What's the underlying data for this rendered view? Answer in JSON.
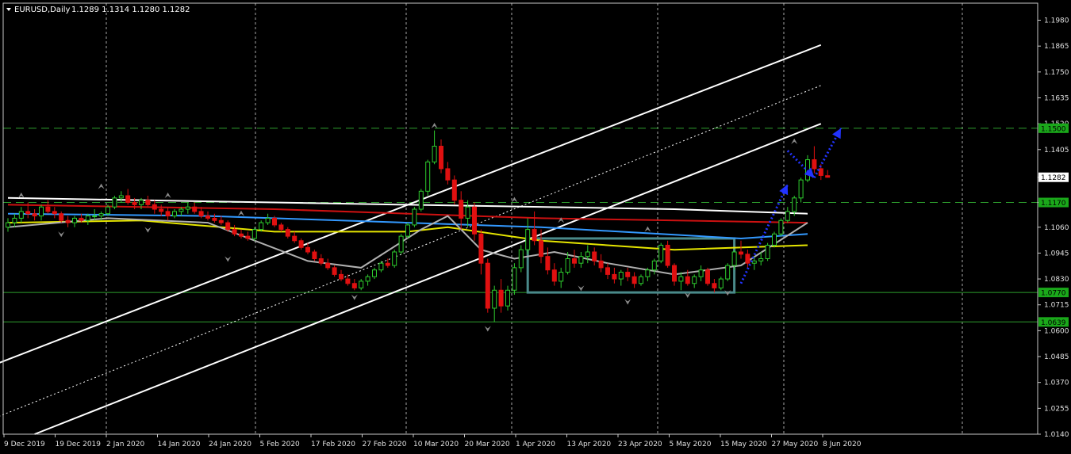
{
  "header": {
    "symbol": "EURUSD,Daily",
    "ohlc": "1.1289 1.1314 1.1280 1.1282"
  },
  "colors": {
    "background": "#000000",
    "bull_candle": "#2ecc2e",
    "bear_candle": "#e01010",
    "ma_white": "#ffffff",
    "ma_red": "#cc1111",
    "ma_blue": "#3399ff",
    "ma_yellow": "#e6e600",
    "ma_gray": "#b0b0b0",
    "channel": "#ffffff",
    "level_line": "#2e9e2e",
    "level_label_bg": "#1aa81a",
    "range_box": "#4a8a8a",
    "forecast_arrow": "#2233ff",
    "fractal": "#8a8a8a"
  },
  "chart_data": {
    "type": "candlestick",
    "symbol": "EURUSD",
    "timeframe": "Daily",
    "ylim": [
      1.014,
      1.201
    ],
    "y_ticks": [
      "1.1980",
      "1.1865",
      "1.1750",
      "1.1635",
      "1.1520",
      "1.1405",
      "1.1282",
      "1.1170",
      "1.1060",
      "1.0945",
      "1.0830",
      "1.0715",
      "1.0600",
      "1.0485",
      "1.0370",
      "1.0255",
      "1.0140"
    ],
    "price_labels": [
      {
        "text": "1.1500",
        "value": 1.15,
        "style": "level"
      },
      {
        "text": "1.1282",
        "value": 1.1282,
        "style": "current"
      },
      {
        "text": "1.1170",
        "value": 1.117,
        "style": "level"
      },
      {
        "text": "1.0770",
        "value": 1.077,
        "style": "level"
      },
      {
        "text": "1.0639",
        "value": 1.0639,
        "style": "level"
      }
    ],
    "x_labels": [
      "9 Dec 2019",
      "19 Dec 2019",
      "2 Jan 2020",
      "14 Jan 2020",
      "24 Jan 2020",
      "5 Feb 2020",
      "17 Feb 2020",
      "27 Feb 2020",
      "10 Mar 2020",
      "20 Mar 2020",
      "1 Apr 2020",
      "13 Apr 2020",
      "23 Apr 2020",
      "5 May 2020",
      "15 May 2020",
      "27 May 2020",
      "8 Jun 2020"
    ],
    "candles": [
      [
        1.106,
        1.11,
        1.104,
        1.108
      ],
      [
        1.108,
        1.112,
        1.106,
        1.11
      ],
      [
        1.11,
        1.115,
        1.108,
        1.113
      ],
      [
        1.113,
        1.117,
        1.11,
        1.112
      ],
      [
        1.112,
        1.114,
        1.109,
        1.111
      ],
      [
        1.111,
        1.116,
        1.109,
        1.115
      ],
      [
        1.115,
        1.118,
        1.112,
        1.113
      ],
      [
        1.113,
        1.115,
        1.11,
        1.112
      ],
      [
        1.112,
        1.113,
        1.108,
        1.109
      ],
      [
        1.109,
        1.111,
        1.106,
        1.108
      ],
      [
        1.108,
        1.111,
        1.106,
        1.11
      ],
      [
        1.11,
        1.112,
        1.108,
        1.109
      ],
      [
        1.109,
        1.112,
        1.107,
        1.111
      ],
      [
        1.111,
        1.114,
        1.109,
        1.111
      ],
      [
        1.111,
        1.113,
        1.109,
        1.112
      ],
      [
        1.112,
        1.116,
        1.111,
        1.115
      ],
      [
        1.115,
        1.12,
        1.114,
        1.119
      ],
      [
        1.119,
        1.122,
        1.117,
        1.12
      ],
      [
        1.12,
        1.123,
        1.116,
        1.117
      ],
      [
        1.117,
        1.119,
        1.114,
        1.116
      ],
      [
        1.116,
        1.119,
        1.114,
        1.118
      ],
      [
        1.118,
        1.12,
        1.115,
        1.116
      ],
      [
        1.116,
        1.118,
        1.112,
        1.114
      ],
      [
        1.114,
        1.116,
        1.111,
        1.113
      ],
      [
        1.113,
        1.115,
        1.109,
        1.111
      ],
      [
        1.111,
        1.114,
        1.11,
        1.113
      ],
      [
        1.113,
        1.115,
        1.111,
        1.114
      ],
      [
        1.114,
        1.117,
        1.112,
        1.115
      ],
      [
        1.115,
        1.117,
        1.112,
        1.113
      ],
      [
        1.113,
        1.115,
        1.11,
        1.111
      ],
      [
        1.111,
        1.113,
        1.109,
        1.11
      ],
      [
        1.11,
        1.112,
        1.108,
        1.109
      ],
      [
        1.109,
        1.111,
        1.107,
        1.108
      ],
      [
        1.108,
        1.109,
        1.104,
        1.105
      ],
      [
        1.105,
        1.107,
        1.102,
        1.103
      ],
      [
        1.103,
        1.105,
        1.101,
        1.102
      ],
      [
        1.102,
        1.104,
        1.1,
        1.101
      ],
      [
        1.101,
        1.106,
        1.1,
        1.105
      ],
      [
        1.105,
        1.109,
        1.104,
        1.108
      ],
      [
        1.108,
        1.112,
        1.107,
        1.11
      ],
      [
        1.11,
        1.111,
        1.106,
        1.107
      ],
      [
        1.107,
        1.108,
        1.104,
        1.105
      ],
      [
        1.105,
        1.106,
        1.101,
        1.102
      ],
      [
        1.102,
        1.104,
        1.099,
        1.1
      ],
      [
        1.1,
        1.101,
        1.096,
        1.097
      ],
      [
        1.097,
        1.099,
        1.094,
        1.095
      ],
      [
        1.095,
        1.096,
        1.091,
        1.092
      ],
      [
        1.092,
        1.094,
        1.089,
        1.09
      ],
      [
        1.09,
        1.092,
        1.087,
        1.088
      ],
      [
        1.088,
        1.089,
        1.084,
        1.085
      ],
      [
        1.085,
        1.087,
        1.082,
        1.083
      ],
      [
        1.083,
        1.085,
        1.08,
        1.081
      ],
      [
        1.081,
        1.083,
        1.078,
        1.079
      ],
      [
        1.079,
        1.083,
        1.078,
        1.082
      ],
      [
        1.082,
        1.085,
        1.08,
        1.084
      ],
      [
        1.084,
        1.088,
        1.083,
        1.087
      ],
      [
        1.087,
        1.091,
        1.086,
        1.09
      ],
      [
        1.09,
        1.092,
        1.088,
        1.089
      ],
      [
        1.089,
        1.096,
        1.088,
        1.095
      ],
      [
        1.095,
        1.103,
        1.094,
        1.102
      ],
      [
        1.102,
        1.108,
        1.101,
        1.107
      ],
      [
        1.107,
        1.115,
        1.106,
        1.114
      ],
      [
        1.114,
        1.123,
        1.113,
        1.122
      ],
      [
        1.122,
        1.136,
        1.12,
        1.135
      ],
      [
        1.135,
        1.149,
        1.134,
        1.142
      ],
      [
        1.142,
        1.145,
        1.13,
        1.132
      ],
      [
        1.132,
        1.135,
        1.125,
        1.127
      ],
      [
        1.127,
        1.129,
        1.116,
        1.118
      ],
      [
        1.118,
        1.122,
        1.105,
        1.11
      ],
      [
        1.11,
        1.118,
        1.106,
        1.115
      ],
      [
        1.115,
        1.117,
        1.1,
        1.103
      ],
      [
        1.103,
        1.105,
        1.085,
        1.09
      ],
      [
        1.09,
        1.092,
        1.068,
        1.07
      ],
      [
        1.07,
        1.08,
        1.0639,
        1.078
      ],
      [
        1.078,
        1.083,
        1.068,
        1.071
      ],
      [
        1.071,
        1.08,
        1.069,
        1.078
      ],
      [
        1.078,
        1.09,
        1.076,
        1.088
      ],
      [
        1.088,
        1.098,
        1.086,
        1.096
      ],
      [
        1.096,
        1.11,
        1.094,
        1.105
      ],
      [
        1.105,
        1.113,
        1.098,
        1.1
      ],
      [
        1.1,
        1.105,
        1.09,
        1.093
      ],
      [
        1.093,
        1.097,
        1.085,
        1.087
      ],
      [
        1.087,
        1.09,
        1.08,
        1.082
      ],
      [
        1.082,
        1.088,
        1.079,
        1.086
      ],
      [
        1.086,
        1.095,
        1.085,
        1.092
      ],
      [
        1.092,
        1.096,
        1.088,
        1.09
      ],
      [
        1.09,
        1.095,
        1.088,
        1.093
      ],
      [
        1.093,
        1.098,
        1.09,
        1.095
      ],
      [
        1.095,
        1.097,
        1.089,
        1.091
      ],
      [
        1.091,
        1.094,
        1.086,
        1.088
      ],
      [
        1.088,
        1.09,
        1.083,
        1.085
      ],
      [
        1.085,
        1.088,
        1.081,
        1.083
      ],
      [
        1.083,
        1.087,
        1.08,
        1.086
      ],
      [
        1.086,
        1.088,
        1.082,
        1.084
      ],
      [
        1.084,
        1.086,
        1.079,
        1.081
      ],
      [
        1.081,
        1.085,
        1.08,
        1.084
      ],
      [
        1.084,
        1.088,
        1.082,
        1.087
      ],
      [
        1.087,
        1.092,
        1.085,
        1.091
      ],
      [
        1.091,
        1.099,
        1.09,
        1.098
      ],
      [
        1.098,
        1.1,
        1.088,
        1.089
      ],
      [
        1.089,
        1.09,
        1.08,
        1.082
      ],
      [
        1.082,
        1.086,
        1.078,
        1.084
      ],
      [
        1.084,
        1.087,
        1.08,
        1.081
      ],
      [
        1.081,
        1.085,
        1.079,
        1.084
      ],
      [
        1.084,
        1.089,
        1.082,
        1.087
      ],
      [
        1.087,
        1.088,
        1.08,
        1.081
      ],
      [
        1.081,
        1.083,
        1.077,
        1.079
      ],
      [
        1.079,
        1.084,
        1.078,
        1.083
      ],
      [
        1.083,
        1.09,
        1.082,
        1.089
      ],
      [
        1.089,
        1.096,
        1.087,
        1.095
      ],
      [
        1.095,
        1.1,
        1.092,
        1.094
      ],
      [
        1.094,
        1.096,
        1.088,
        1.09
      ],
      [
        1.09,
        1.093,
        1.087,
        1.091
      ],
      [
        1.091,
        1.095,
        1.089,
        1.092
      ],
      [
        1.092,
        1.099,
        1.091,
        1.098
      ],
      [
        1.098,
        1.104,
        1.097,
        1.103
      ],
      [
        1.103,
        1.11,
        1.102,
        1.109
      ],
      [
        1.109,
        1.115,
        1.108,
        1.113
      ],
      [
        1.113,
        1.12,
        1.111,
        1.119
      ],
      [
        1.119,
        1.128,
        1.117,
        1.127
      ],
      [
        1.127,
        1.138,
        1.126,
        1.136
      ],
      [
        1.136,
        1.142,
        1.13,
        1.132
      ],
      [
        1.132,
        1.134,
        1.127,
        1.129
      ],
      [
        1.1289,
        1.1314,
        1.128,
        1.1282
      ]
    ],
    "moving_averages": [
      {
        "name": "white",
        "color": "#ffffff",
        "points": [
          [
            0,
            1.119
          ],
          [
            60,
            1.116
          ],
          [
            100,
            1.114
          ],
          [
            120,
            1.112
          ]
        ]
      },
      {
        "name": "red",
        "color": "#cc1111",
        "points": [
          [
            0,
            1.116
          ],
          [
            40,
            1.114
          ],
          [
            80,
            1.11
          ],
          [
            120,
            1.108
          ]
        ]
      },
      {
        "name": "blue",
        "color": "#3399ff",
        "points": [
          [
            0,
            1.112
          ],
          [
            30,
            1.111
          ],
          [
            60,
            1.108
          ],
          [
            80,
            1.106
          ],
          [
            110,
            1.101
          ],
          [
            120,
            1.103
          ]
        ]
      },
      {
        "name": "yellow",
        "color": "#e6e600",
        "points": [
          [
            0,
            1.108
          ],
          [
            20,
            1.109
          ],
          [
            40,
            1.104
          ],
          [
            60,
            1.104
          ],
          [
            66,
            1.106
          ],
          [
            80,
            1.1
          ],
          [
            100,
            1.096
          ],
          [
            120,
            1.098
          ]
        ]
      },
      {
        "name": "gray",
        "color": "#b0b0b0",
        "points": [
          [
            0,
            1.106
          ],
          [
            15,
            1.11
          ],
          [
            30,
            1.108
          ],
          [
            45,
            1.091
          ],
          [
            53,
            1.088
          ],
          [
            62,
            1.105
          ],
          [
            66,
            1.111
          ],
          [
            71,
            1.096
          ],
          [
            76,
            1.092
          ],
          [
            82,
            1.095
          ],
          [
            90,
            1.09
          ],
          [
            100,
            1.085
          ],
          [
            110,
            1.089
          ],
          [
            120,
            1.108
          ]
        ]
      }
    ],
    "channel_lines": [
      {
        "name": "upper",
        "style": "solid",
        "points": [
          [
            -29,
            1.014
          ],
          [
            122,
            1.187
          ]
        ]
      },
      {
        "name": "middle",
        "style": "dotted",
        "points": [
          [
            -8,
            1.014
          ],
          [
            122,
            1.169
          ]
        ]
      },
      {
        "name": "lower",
        "style": "solid",
        "points": [
          [
            4,
            1.014
          ],
          [
            122,
            1.152
          ]
        ]
      }
    ],
    "horizontal_levels": [
      {
        "value": 1.15,
        "style": "dashed"
      },
      {
        "value": 1.117,
        "style": "dashed"
      },
      {
        "value": 1.077,
        "style": "solid"
      },
      {
        "value": 1.0639,
        "style": "solid"
      }
    ],
    "range_box": {
      "x_start": 78,
      "x_end": 109,
      "y_top": 1.101,
      "y_bottom": 1.077
    },
    "forecast_arrows": [
      {
        "points": [
          [
            110,
            1.081
          ],
          [
            117,
            1.125
          ]
        ]
      },
      {
        "points": [
          [
            117,
            1.14
          ],
          [
            121,
            1.128
          ]
        ]
      },
      {
        "points": [
          [
            121,
            1.128
          ],
          [
            125,
            1.15
          ]
        ]
      }
    ],
    "fractals_up": [
      [
        2,
        1.12
      ],
      [
        14,
        1.124
      ],
      [
        24,
        1.12
      ],
      [
        35,
        1.112
      ],
      [
        64,
        1.151
      ],
      [
        76,
        1.118
      ],
      [
        83,
        1.109
      ],
      [
        96,
        1.105
      ],
      [
        118,
        1.144
      ]
    ],
    "fractals_down": [
      [
        8,
        1.103
      ],
      [
        21,
        1.105
      ],
      [
        33,
        1.092
      ],
      [
        52,
        1.075
      ],
      [
        72,
        1.061
      ],
      [
        86,
        1.079
      ],
      [
        93,
        1.073
      ],
      [
        102,
        1.076
      ],
      [
        108,
        1.077
      ]
    ]
  }
}
